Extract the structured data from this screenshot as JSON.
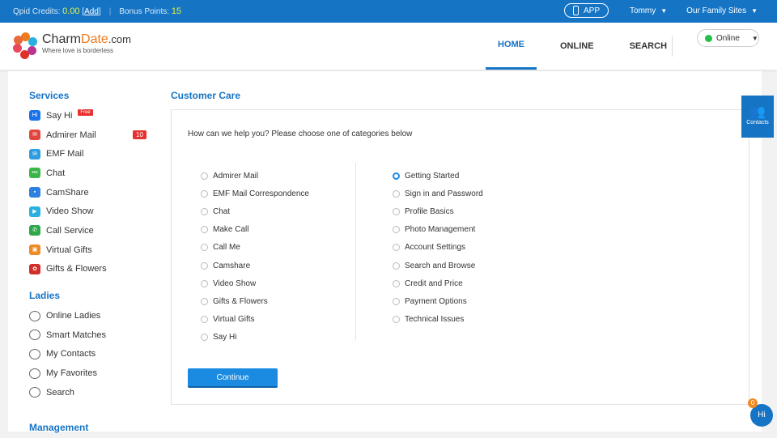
{
  "topbar": {
    "credits_label": "Qpid Credits:",
    "credits": "0.00",
    "add": "Add",
    "bonus_label": "Bonus Points:",
    "bonus": "15",
    "app": "APP",
    "user": "Tommy",
    "family": "Our Family Sites"
  },
  "logo": {
    "name_a": "Charm",
    "name_b": "Date",
    "name_c": ".com",
    "tagline": "Where love is borderless"
  },
  "nav": [
    "HOME",
    "ONLINE",
    "SEARCH"
  ],
  "status": "Online",
  "sidebar": {
    "services_title": "Services",
    "services": [
      {
        "label": "Say Hi",
        "icon": "hi-icon",
        "color": "#1a73e8"
      },
      {
        "label": "Admirer Mail",
        "icon": "admirer-mail-icon",
        "color": "#e0463e"
      },
      {
        "label": "EMF Mail",
        "icon": "envelope-icon",
        "color": "#2d9de0"
      },
      {
        "label": "Chat",
        "icon": "chat-icon",
        "color": "#3cb54a"
      },
      {
        "label": "CamShare",
        "icon": "camera-icon",
        "color": "#2b80e0"
      },
      {
        "label": "Video Show",
        "icon": "play-icon",
        "color": "#2ab0e0"
      },
      {
        "label": "Call Service",
        "icon": "phone-icon",
        "color": "#2ea84a"
      },
      {
        "label": "Virtual Gifts",
        "icon": "gift-icon",
        "color": "#f08a24"
      },
      {
        "label": "Gifts & Flowers",
        "icon": "rose-icon",
        "color": "#d0302a"
      }
    ],
    "free": "Free",
    "admirer_count": "10",
    "ladies_title": "Ladies",
    "ladies": [
      {
        "label": "Online Ladies",
        "icon": "person-icon"
      },
      {
        "label": "Smart Matches",
        "icon": "hearts-icon"
      },
      {
        "label": "My Contacts",
        "icon": "people-icon"
      },
      {
        "label": "My Favorites",
        "icon": "heart-icon"
      },
      {
        "label": "Search",
        "icon": "search-icon"
      }
    ],
    "management_title": "Management"
  },
  "care": {
    "title": "Customer Care",
    "question": "How can we help you? Please choose one of categories below",
    "left": [
      "Admirer Mail",
      "EMF Mail Correspondence",
      "Chat",
      "Make Call",
      "Call Me",
      "Camshare",
      "Video Show",
      "Gifts & Flowers",
      "Virtual Gifts",
      "Say Hi"
    ],
    "right": [
      "Getting Started",
      "Sign in and Password",
      "Profile Basics",
      "Photo Management",
      "Account Settings",
      "Search and Browse",
      "Credit and Price",
      "Payment Options",
      "Technical Issues"
    ],
    "selected": "Getting Started",
    "continue": "Continue"
  },
  "contacts": "Contacts",
  "hi": {
    "label": "Hi",
    "count": "0"
  }
}
